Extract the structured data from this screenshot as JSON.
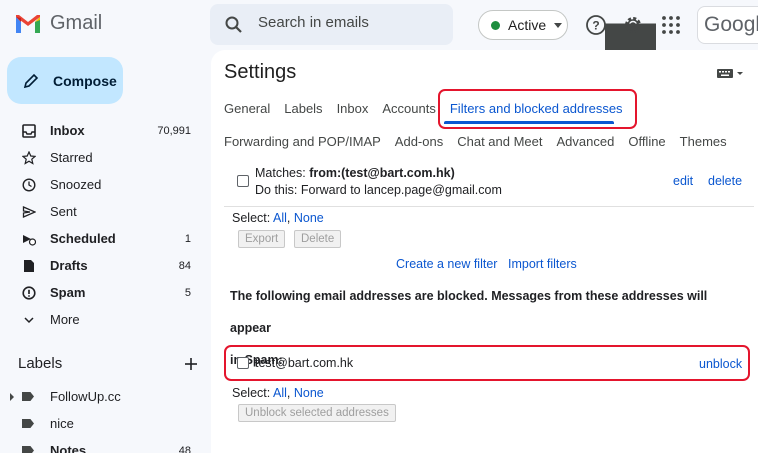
{
  "app": {
    "name": "Gmail"
  },
  "search": {
    "placeholder": "Search in emails"
  },
  "status": {
    "label": "Active"
  },
  "brand": {
    "label": "Googl"
  },
  "compose": {
    "label": "Compose"
  },
  "nav": [
    {
      "label": "Inbox",
      "count": "70,991",
      "bold": true,
      "icon": "inbox-icon"
    },
    {
      "label": "Starred",
      "count": "",
      "bold": false,
      "icon": "star-icon"
    },
    {
      "label": "Snoozed",
      "count": "",
      "bold": false,
      "icon": "clock-icon"
    },
    {
      "label": "Sent",
      "count": "",
      "bold": false,
      "icon": "send-icon"
    },
    {
      "label": "Scheduled",
      "count": "1",
      "bold": true,
      "icon": "scheduled-icon"
    },
    {
      "label": "Drafts",
      "count": "84",
      "bold": true,
      "icon": "draft-icon"
    },
    {
      "label": "Spam",
      "count": "5",
      "bold": true,
      "icon": "spam-icon"
    },
    {
      "label": "More",
      "count": "",
      "bold": false,
      "icon": "chevron-down-icon"
    }
  ],
  "labels": {
    "title": "Labels",
    "items": [
      {
        "label": "FollowUp.cc",
        "count": "",
        "bold": false,
        "expandable": true
      },
      {
        "label": "nice",
        "count": "",
        "bold": false,
        "expandable": false
      },
      {
        "label": "Notes",
        "count": "48",
        "bold": true,
        "expandable": false
      }
    ]
  },
  "settings": {
    "title": "Settings",
    "tabs_row1": [
      "General",
      "Labels",
      "Inbox",
      "Accounts",
      "Filters and blocked addresses"
    ],
    "tabs_row2": [
      "Forwarding and POP/IMAP",
      "Add-ons",
      "Chat and Meet",
      "Advanced",
      "Offline",
      "Themes"
    ],
    "active_tab": "Filters and blocked addresses"
  },
  "filter": {
    "matches_label": "Matches:",
    "matches_value": "from:(test@bart.com.hk)",
    "action_label": "Do this:",
    "action_value": "Forward to lancep.page@gmail.com",
    "edit": "edit",
    "delete": "delete"
  },
  "filter_select": {
    "label": "Select:",
    "all": "All",
    "none": "None"
  },
  "filter_buttons": {
    "export": "Export",
    "delete": "Delete"
  },
  "filter_links": {
    "create": "Create a new filter",
    "import": "Import filters"
  },
  "blocked": {
    "line1": "The following email addresses are blocked. Messages from these addresses will appear",
    "line2": "in Spam:",
    "address": "test@bart.com.hk",
    "unblock": "unblock"
  },
  "blocked_select": {
    "label": "Select:",
    "all": "All",
    "none": "None"
  },
  "blocked_buttons": {
    "unblock_selected": "Unblock selected addresses"
  },
  "colors": {
    "accent": "#0b57d0",
    "compose_bg": "#c2e7ff",
    "highlight": "#e4152d",
    "active_dot": "#1e8e3e"
  }
}
